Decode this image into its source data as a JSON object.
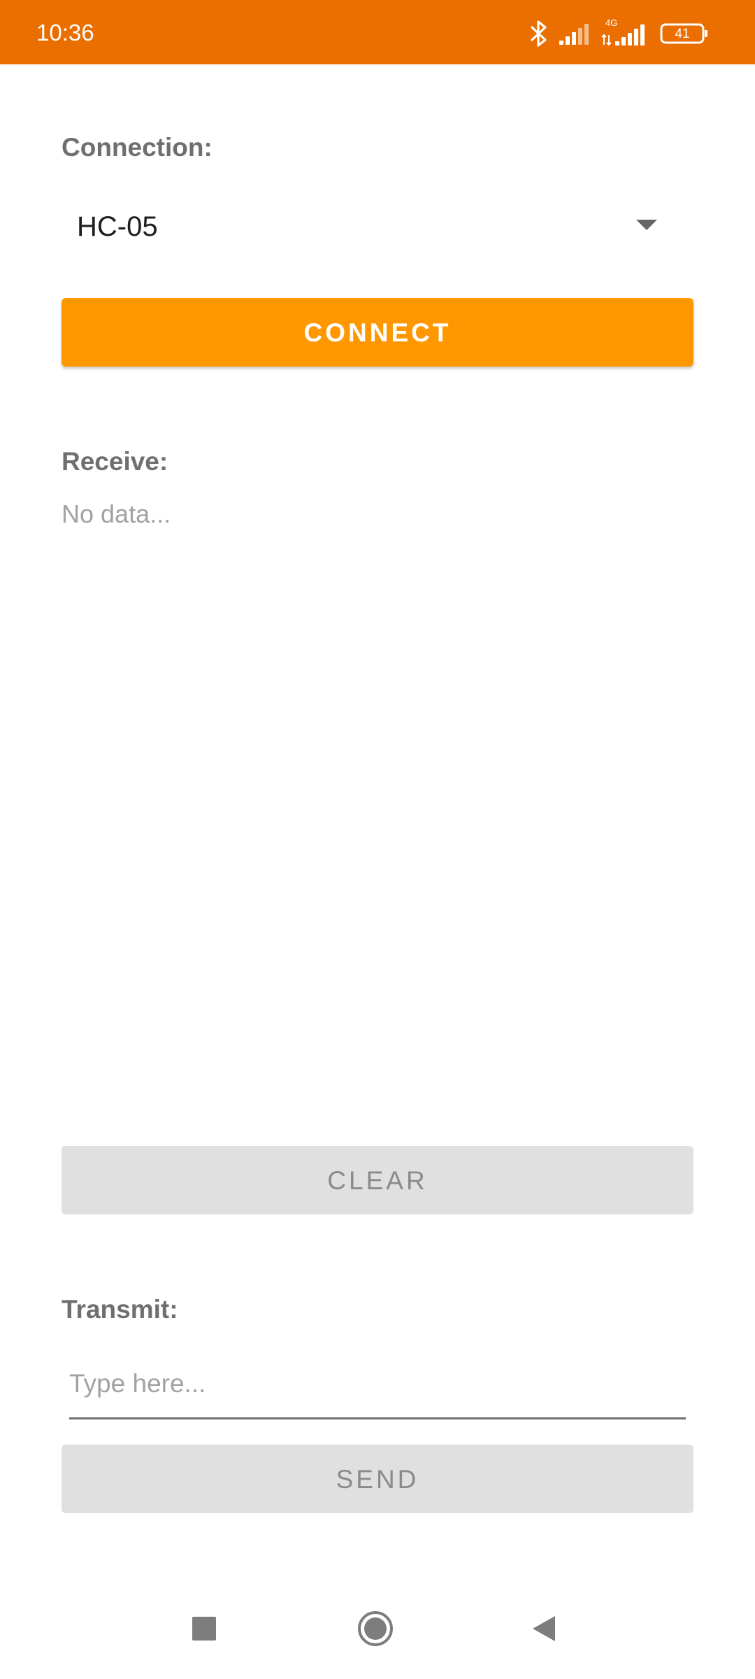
{
  "status_bar": {
    "time": "10:36",
    "network_type": "4G",
    "battery_level": "41",
    "background_color": "#ea6e00",
    "icons": [
      "bluetooth-icon",
      "signal-icon",
      "signal-4g-icon",
      "battery-icon"
    ]
  },
  "connection": {
    "label": "Connection:",
    "selected_device": "HC-05",
    "connect_label": "CONNECT"
  },
  "receive": {
    "label": "Receive:",
    "data_text": "No data...",
    "clear_label": "CLEAR"
  },
  "transmit": {
    "label": "Transmit:",
    "input_value": "",
    "input_placeholder": "Type here...",
    "send_label": "SEND"
  },
  "nav_bar": {
    "icons": [
      "recent-apps-icon",
      "home-icon",
      "back-icon"
    ]
  },
  "colors": {
    "accent": "#ff9800",
    "status_bar": "#ea6e00",
    "disabled_button": "#e0e0e0",
    "label_text": "#6f6f6f"
  }
}
